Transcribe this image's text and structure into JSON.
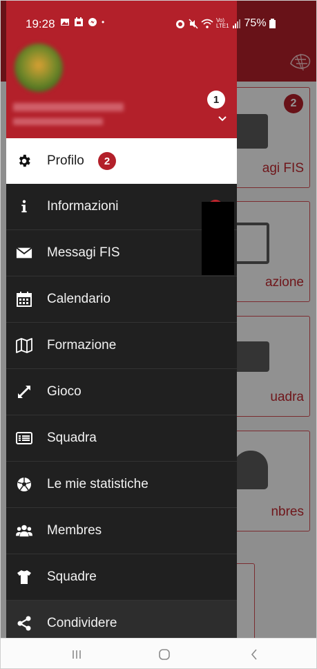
{
  "status_bar": {
    "time": "19:28",
    "battery": "75%",
    "left_icons": [
      "gallery-icon",
      "calendar-icon",
      "messenger-icon",
      "dot-icon"
    ],
    "right_icons": [
      "alarm-icon",
      "mute-icon",
      "wifi-icon",
      "volte-icon",
      "signal-icon",
      "battery-icon"
    ]
  },
  "drawer": {
    "account_badge": "1",
    "items": [
      {
        "label": "Profilo",
        "icon": "gear-icon",
        "badge": "2",
        "active": true
      },
      {
        "label": "Informazioni",
        "icon": "info-icon"
      },
      {
        "label": "Messagi FIS",
        "icon": "envelope-icon"
      },
      {
        "label": "Calendario",
        "icon": "calendar-icon"
      },
      {
        "label": "Formazione",
        "icon": "map-icon"
      },
      {
        "label": "Gioco",
        "icon": "expand-icon"
      },
      {
        "label": "Squadra",
        "icon": "list-card-icon"
      },
      {
        "label": "Le mie statistiche",
        "icon": "soccer-ball-icon"
      },
      {
        "label": "Membres",
        "icon": "users-icon"
      },
      {
        "label": "Squadre",
        "icon": "shirt-icon"
      },
      {
        "label": "Condividere",
        "icon": "share-icon"
      }
    ]
  },
  "background": {
    "cards": [
      {
        "label": "agi FIS",
        "badge": "2"
      },
      {
        "label": "azione"
      },
      {
        "label": "uadra"
      },
      {
        "label": "nbres"
      },
      {
        "label": ""
      }
    ]
  },
  "nav": {
    "recents": "recents-icon",
    "home": "home-icon",
    "back": "back-icon"
  },
  "colors": {
    "brand_red": "#b3202a",
    "drawer_bg": "#202020",
    "active_item_bg": "#ffffff"
  }
}
